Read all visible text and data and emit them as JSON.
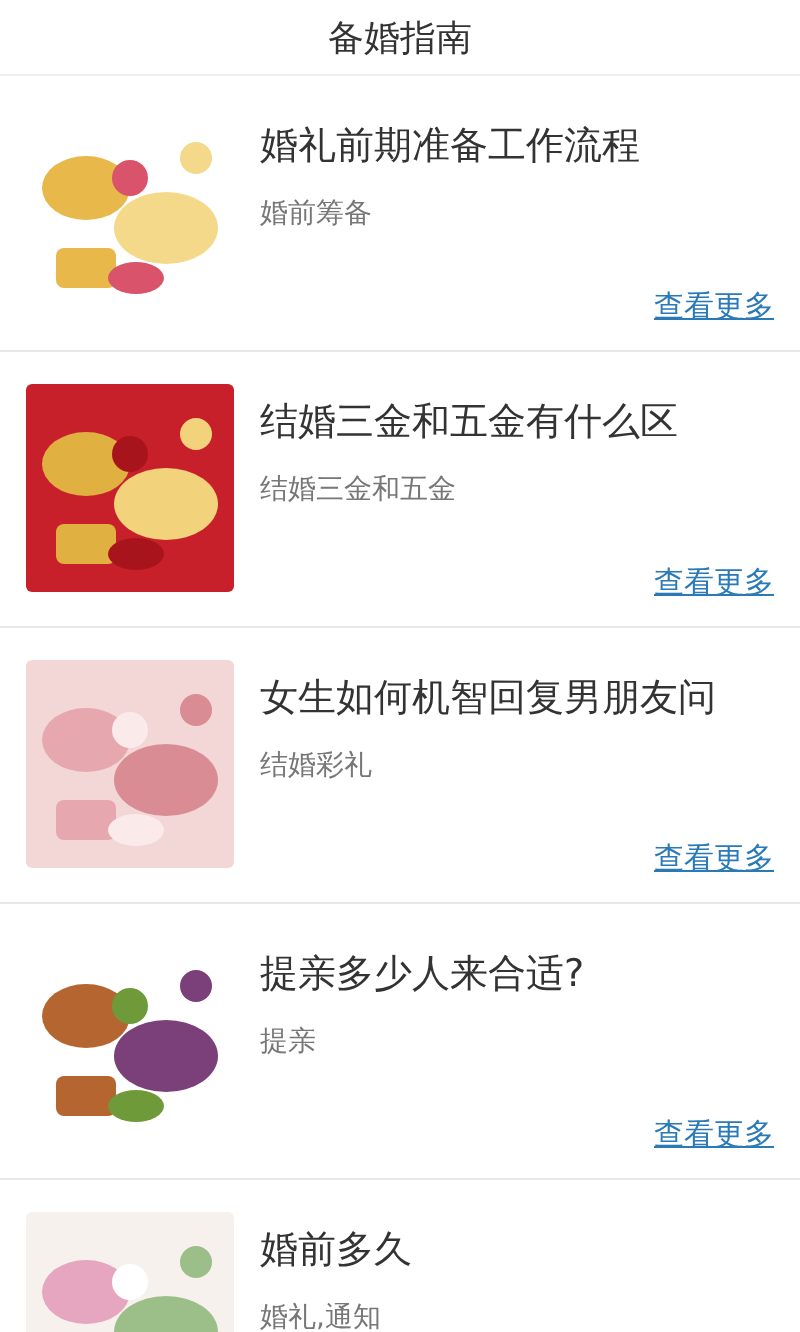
{
  "header": {
    "title": "备婚指南"
  },
  "articles": [
    {
      "title": "婚礼前期准备工作流程",
      "tag": "婚前筹备",
      "more": "查看更多"
    },
    {
      "title": "结婚三金和五金有什么区",
      "tag": "结婚三金和五金",
      "more": "查看更多"
    },
    {
      "title": "女生如何机智回复男朋友问",
      "tag": "结婚彩礼",
      "more": "查看更多"
    },
    {
      "title": "提亲多少人来合适?",
      "tag": "提亲",
      "more": "查看更多"
    },
    {
      "title": "婚前多久",
      "tag": "婚礼,通知"
    }
  ]
}
